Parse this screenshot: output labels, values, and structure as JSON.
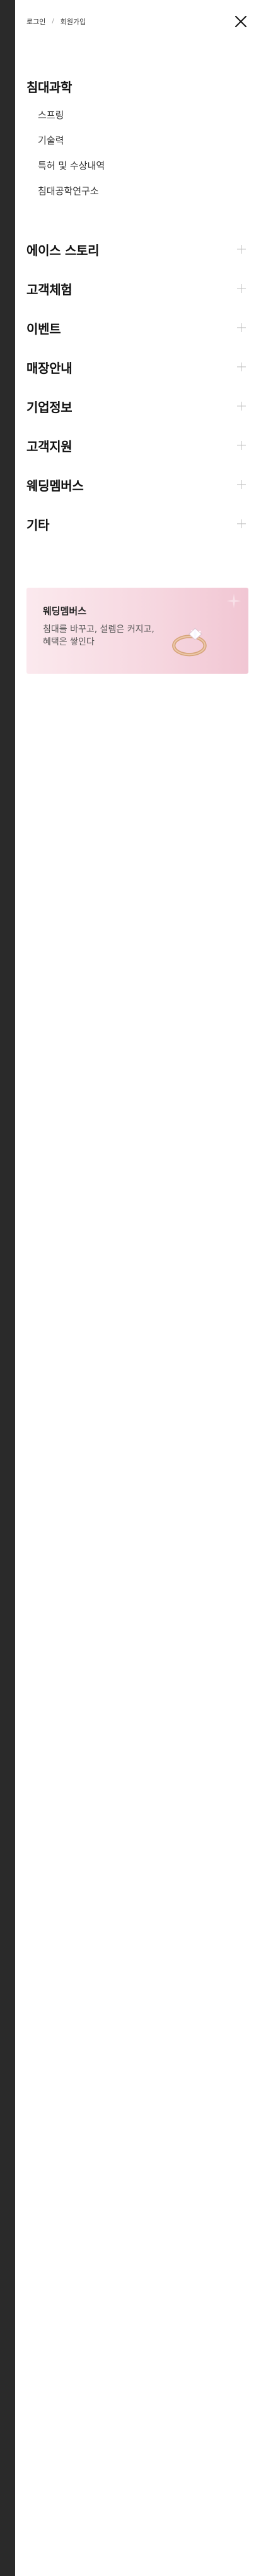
{
  "top": {
    "login": "로그인",
    "separator": "/",
    "signup": "회원가입"
  },
  "main_section": {
    "title": "침대과학",
    "items": [
      "스프링",
      "기술력",
      "특허 및 수상내역",
      "침대공학연구소"
    ]
  },
  "accordion": {
    "items": [
      "에이스 스토리",
      "고객체험",
      "이벤트",
      "매장안내",
      "기업정보",
      "고객지원",
      "웨딩멤버스",
      "기타"
    ]
  },
  "promo": {
    "title": "웨딩멤버스",
    "desc": "침대를 바꾸고, 설렘은 커지고, 혜택은 쌓인다"
  },
  "icons": {
    "close": "close-icon",
    "plus": "plus-icon",
    "ring": "ring-icon"
  },
  "colors": {
    "background_dim": "#2a2a2a",
    "drawer_bg": "#ffffff",
    "promo_pink": "#f6d6df"
  }
}
